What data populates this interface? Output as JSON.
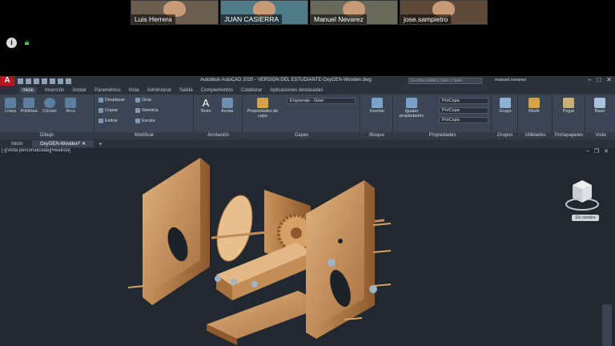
{
  "meeting": {
    "participants": [
      {
        "name": "Luis Herrera",
        "bg": "#6b5e4f"
      },
      {
        "name": "JUAN CASIERRA",
        "bg": "#4f7c88"
      },
      {
        "name": "Manuel Nevarez",
        "bg": "#6a6a5c"
      },
      {
        "name": "jose.sampietro",
        "bg": "#5d4a3b"
      }
    ],
    "icons": [
      "info-icon",
      "lock-icon"
    ]
  },
  "app": {
    "logo": "A",
    "title": "Autodesk AutoCAD 2020 - VERSIÓN DEL ESTUDIANTE    OxyGEN-Wooden.dwg",
    "search_placeholder": "Escriba palabra clave o frase",
    "user": "manuel.nevarez"
  },
  "ribbon_tabs": [
    "Inicio",
    "Inserción",
    "Anotar",
    "Paramétrico",
    "Vista",
    "Administrar",
    "Salida",
    "Complementos",
    "Colaborar",
    "Aplicaciones destacadas"
  ],
  "ribbon": {
    "dibujo": {
      "title": "Dibujo",
      "tools": [
        "Línea",
        "Polilínea",
        "Círculo",
        "Arco"
      ]
    },
    "modificar": {
      "title": "Modificar",
      "tools": [
        "Desplazar",
        "Girar",
        "Copiar",
        "Simetría",
        "Estirar",
        "Escala"
      ]
    },
    "anotacion": {
      "title": "Anotación",
      "tools": [
        "Texto",
        "Acotar"
      ]
    },
    "capas": {
      "title": "Capas",
      "tool": "Propiedades de capa",
      "layer_combo": "Engranaje - Gear"
    },
    "bloque": {
      "title": "Bloque",
      "tool": "Insertar"
    },
    "propiedades": {
      "title": "Propiedades",
      "tool": "Igualar propiedades",
      "combos": [
        "PorCapa",
        "PorCapa",
        "PorCapa"
      ]
    },
    "grupos": {
      "title": "Grupos",
      "tool": "Grupo"
    },
    "utilidades": {
      "title": "Utilidades",
      "tool": "Medir"
    },
    "portapapeles": {
      "title": "Portapapeles",
      "tool": "Pegar"
    },
    "vista": {
      "title": "Vista",
      "tool": "Base"
    }
  },
  "file_tabs": [
    "Inicio",
    "OxyGEN-Wooden*"
  ],
  "viewport": {
    "label": "[-][Vista personalizada][Realista]",
    "viewcube_label": "Sin nombre"
  }
}
